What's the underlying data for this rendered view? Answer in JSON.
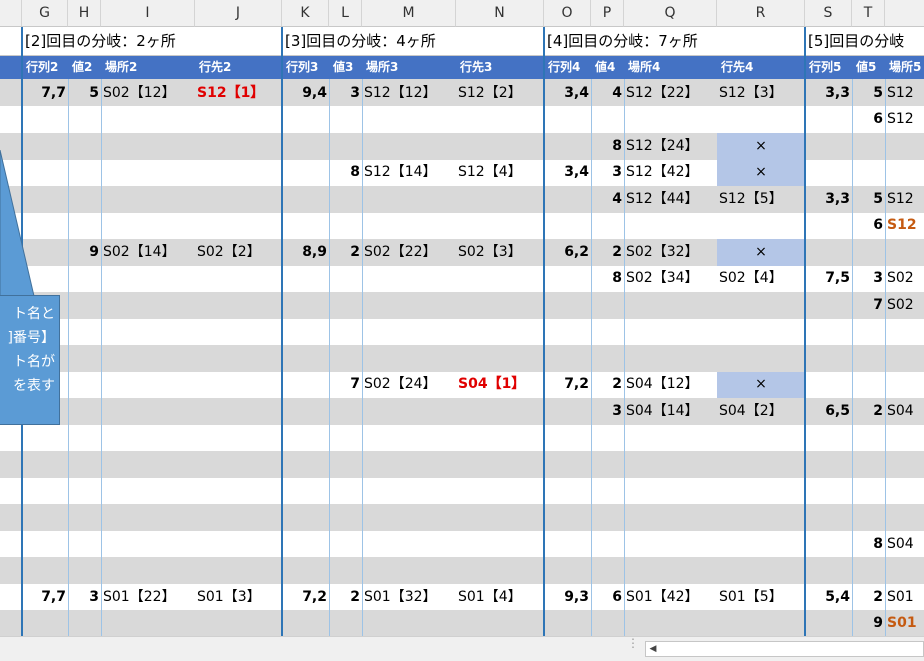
{
  "columns": [
    "G",
    "H",
    "I",
    "J",
    "K",
    "L",
    "M",
    "N",
    "O",
    "P",
    "Q",
    "R",
    "S",
    "T"
  ],
  "sections": [
    {
      "title": "[2]回目の分岐：2ヶ所"
    },
    {
      "title": "[3]回目の分岐：4ヶ所"
    },
    {
      "title": "[4]回目の分岐：7ヶ所"
    },
    {
      "title": "[5]回目の分岐"
    }
  ],
  "subheaders": [
    "行列2",
    "値2",
    "場所2",
    "行先2",
    "行列3",
    "値3",
    "場所3",
    "行先3",
    "行列4",
    "値4",
    "場所4",
    "行先4",
    "行列5",
    "値5",
    "場所5"
  ],
  "callout_lines": [
    "ト名と",
    "]番号】",
    "ト名が",
    "を表す"
  ],
  "cells": {
    "g1": "7,7",
    "h1": "5",
    "i1": "S02【12】",
    "j1": "S12【1】",
    "k1": "9,4",
    "l1": "3",
    "m1": "S12【12】",
    "n1": "S12【2】",
    "o1": "3,4",
    "p1": "4",
    "q1": "S12【22】",
    "r1": "S12【3】",
    "s1": "3,3",
    "t1": "5",
    "u1": "S12",
    "t2": "6",
    "u2": "S12",
    "p3": "8",
    "q3": "S12【24】",
    "r3": "×",
    "l4": "8",
    "m4": "S12【14】",
    "n4": "S12【4】",
    "o4": "3,4",
    "p4": "3",
    "q4": "S12【42】",
    "r4": "×",
    "p5": "4",
    "q5": "S12【44】",
    "r5": "S12【5】",
    "s5": "3,3",
    "t5": "5",
    "u5": "S12",
    "t6": "6",
    "u6": "S12",
    "h7": "9",
    "i7": "S02【14】",
    "j7": "S02【2】",
    "k7": "8,9",
    "l7": "2",
    "m7": "S02【22】",
    "n7": "S02【3】",
    "o7": "6,2",
    "p7": "2",
    "q7": "S02【32】",
    "r7": "×",
    "p8": "8",
    "q8": "S02【34】",
    "r8": "S02【4】",
    "s8": "7,5",
    "t8": "3",
    "u8": "S02",
    "t9": "7",
    "u9": "S02",
    "l12": "7",
    "m12": "S02【24】",
    "n12": "S04【1】",
    "o12": "7,2",
    "p12": "2",
    "q12": "S04【12】",
    "r12": "×",
    "p13": "3",
    "q13": "S04【14】",
    "r13": "S04【2】",
    "s13": "6,5",
    "t13": "2",
    "u13": "S04",
    "t18": "8",
    "u18": "S04",
    "g20": "7,7",
    "h20": "3",
    "i20": "S01【22】",
    "j20": "S01【3】",
    "k20": "7,2",
    "l20": "2",
    "m20": "S01【32】",
    "n20": "S01【4】",
    "o20": "9,3",
    "p20": "6",
    "q20": "S01【42】",
    "r20": "S01【5】",
    "s20": "5,4",
    "t20": "2",
    "u20": "S01",
    "t21": "9",
    "u21": "S01"
  },
  "colors": {
    "header_blue": "#4472c4",
    "band_gray": "#d9d9d9",
    "highlight": "#b4c6e7",
    "red_text": "#e00000",
    "orange_text": "#c55a11",
    "callout": "#5b9bd5"
  }
}
